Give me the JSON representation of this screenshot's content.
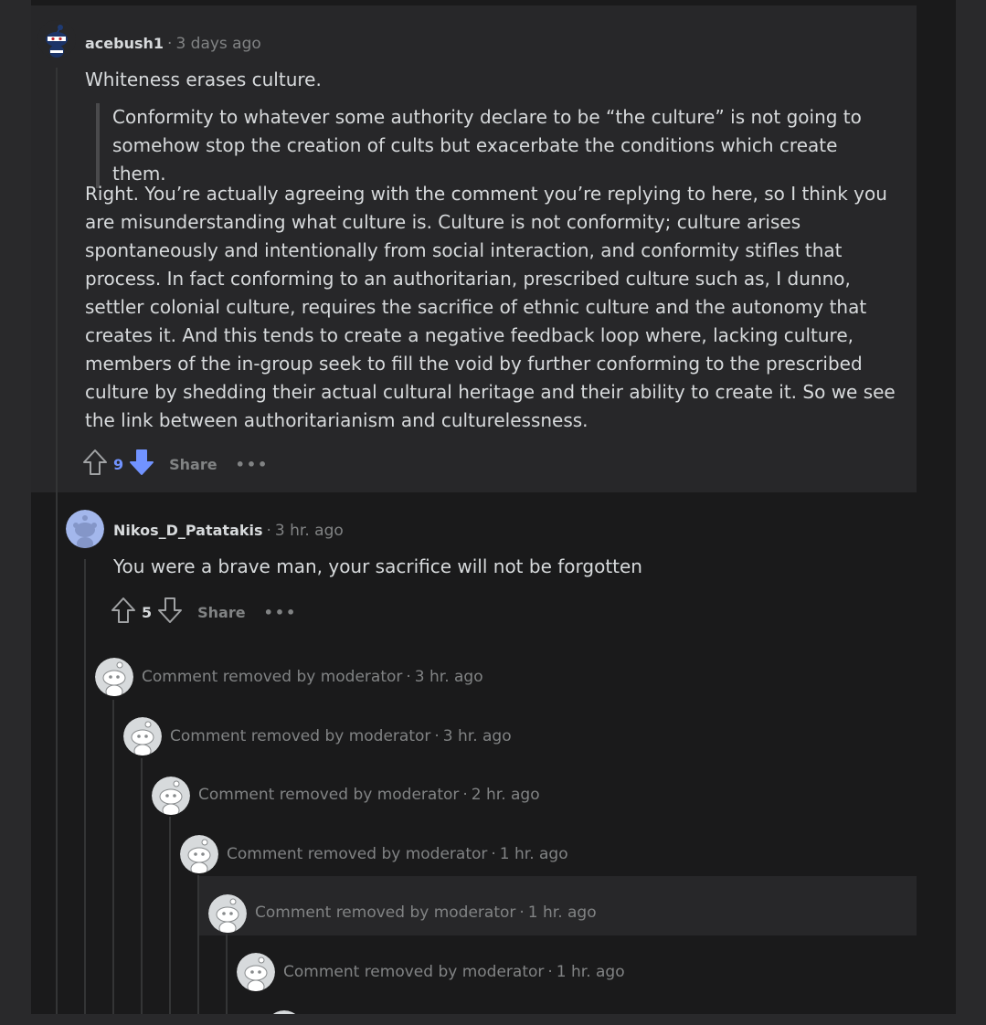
{
  "comments": [
    {
      "username": "acebush1",
      "separator": "·",
      "time": "3 days ago",
      "body_first": "Whiteness erases culture.",
      "quote": "Conformity to whatever some authority declare to be “the culture” is not going to somehow stop the creation of cults but exacerbate the conditions which create them.",
      "body_rest": "Right. You’re actually agreeing with the comment you’re replying to here, so I think you are misunderstanding what culture is. Culture is not conformity; culture arises spontaneously and intentionally from social interaction, and conformity stifles that process. In fact conforming to an authoritarian, prescribed culture such as, I dunno, settler colonial culture, requires the sacrifice of ethnic culture and the autonomy that creates it. And this tends to create a negative feedback loop where, lacking culture, members of the in-group seek to fill the void by further conforming to the prescribed culture by shedding their actual cultural heritage and their ability to create it. So we see the link between authoritarianism and culturelessness.",
      "votes": "9",
      "vote_state": "downvoted",
      "share_label": "Share",
      "more_label": "•••"
    },
    {
      "username": "Nikos_D_Patatakis",
      "separator": "·",
      "time": "3 hr. ago",
      "body": "You were a brave man, your sacrifice will not be forgotten",
      "votes": "5",
      "vote_state": "none",
      "share_label": "Share",
      "more_label": "•••"
    }
  ],
  "removed_comments": [
    {
      "text": "Comment removed by moderator",
      "separator": "·",
      "time": "3 hr. ago"
    },
    {
      "text": "Comment removed by moderator",
      "separator": "·",
      "time": "3 hr. ago"
    },
    {
      "text": "Comment removed by moderator",
      "separator": "·",
      "time": "2 hr. ago"
    },
    {
      "text": "Comment removed by moderator",
      "separator": "·",
      "time": "1 hr. ago"
    },
    {
      "text": "Comment removed by moderator",
      "separator": "·",
      "time": "1 hr. ago"
    },
    {
      "text": "Comment removed by moderator",
      "separator": "·",
      "time": "1 hr. ago"
    }
  ],
  "colors": {
    "background": "#1a1a1b",
    "highlight": "#272729",
    "text": "#d7dadc",
    "muted": "#818384",
    "downvote": "#7193ff",
    "avatar_blue": "#a3b7ec"
  }
}
